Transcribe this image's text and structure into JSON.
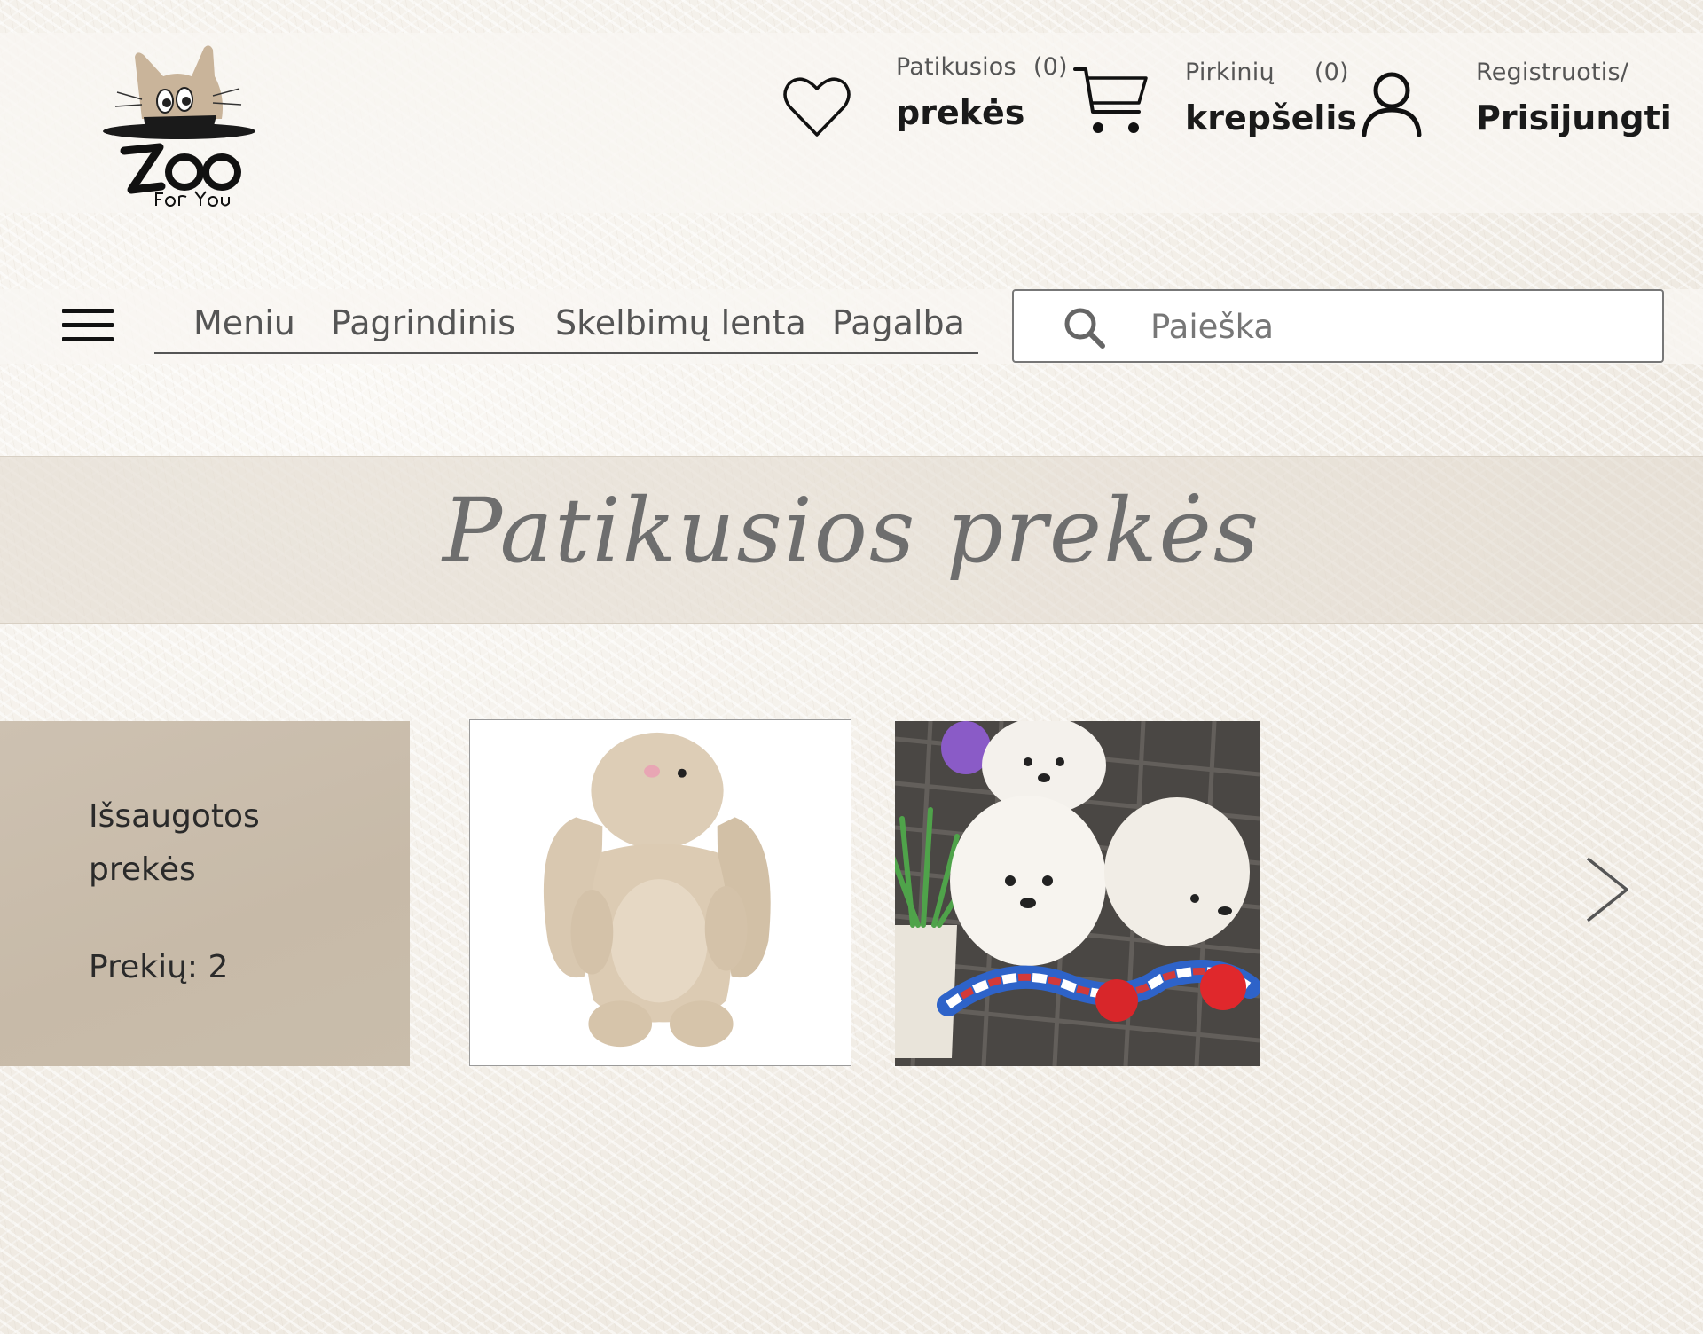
{
  "header": {
    "logo": {
      "brand": "Zoo",
      "tagline": "for You"
    },
    "favorites": {
      "label_top": "Patikusios",
      "count": "(0)",
      "label_bottom": "prekės",
      "icon": "heart-icon"
    },
    "cart": {
      "label_top": "Pirkinių",
      "count": "(0)",
      "label_bottom": "krepšelis",
      "icon": "cart-icon"
    },
    "account": {
      "label_top": "Registruotis/",
      "label_bottom": "Prisijungti",
      "icon": "user-icon"
    }
  },
  "nav": {
    "menu_icon": "hamburger-icon",
    "links": [
      "Meniu",
      "Pagrindinis",
      "Skelbimų lenta",
      "Pagalba"
    ]
  },
  "search": {
    "placeholder": "Paieška",
    "value": "",
    "icon": "search-icon"
  },
  "page": {
    "title": "Patikusios prekės"
  },
  "saved": {
    "title_line1": "Išsaugotos",
    "title_line2": "prekės",
    "count_text": "Prekių: 2"
  },
  "products": [
    {
      "name": "bunny-plush-toy"
    },
    {
      "name": "white-puppies-photo"
    }
  ],
  "carousel": {
    "next_icon": "chevron-right-icon"
  },
  "colors": {
    "panel": "#c9bdab",
    "title_band": "#e2dace",
    "title_text": "#6e6e6e",
    "logo_cat": "#c9b49a"
  }
}
